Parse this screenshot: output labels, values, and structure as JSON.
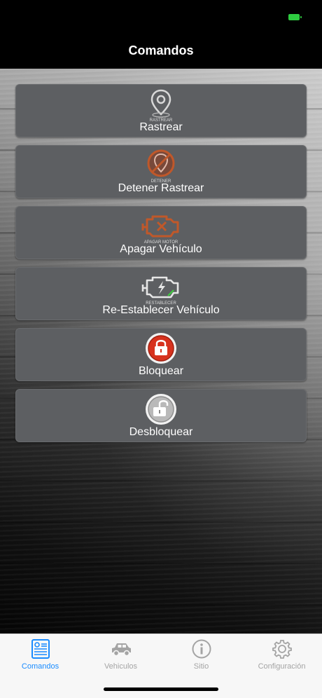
{
  "nav": {
    "title": "Comandos"
  },
  "status": {
    "battery_color": "#2ecc40",
    "battery_state": "charging"
  },
  "commands": [
    {
      "label": "Rastrear",
      "icon": "location-pin-icon",
      "icon_caption": "RASTREAR"
    },
    {
      "label": "Detener Rastrear",
      "icon": "stop-tracking-icon",
      "icon_caption": "DETENER"
    },
    {
      "label": "Apagar Vehículo",
      "icon": "engine-off-icon",
      "icon_caption": "APAGAR MOTOR"
    },
    {
      "label": "Re-Establecer Vehículo",
      "icon": "engine-restore-icon",
      "icon_caption": "RESTABLECER"
    },
    {
      "label": "Bloquear",
      "icon": "lock-icon"
    },
    {
      "label": "Desbloquear",
      "icon": "unlock-icon"
    }
  ],
  "tabs": [
    {
      "label": "Comandos",
      "icon": "commands-icon",
      "active": true
    },
    {
      "label": "Vehiculos",
      "icon": "car-icon",
      "active": false
    },
    {
      "label": "Sitio",
      "icon": "info-icon",
      "active": false
    },
    {
      "label": "Configuración",
      "icon": "gear-icon",
      "active": false
    }
  ],
  "colors": {
    "accent": "#1a8cff",
    "button_bg": "#5d5f62",
    "lock_red": "#d7321e",
    "disabled_orange": "#c0582a"
  }
}
